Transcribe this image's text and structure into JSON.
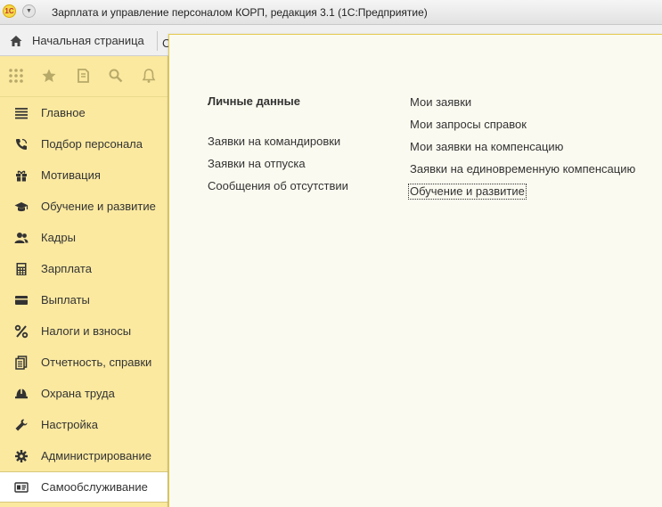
{
  "window": {
    "title": "Зарплата и управление персоналом КОРП, редакция 3.1  (1С:Предприятие)",
    "logo_text": "1С"
  },
  "tabs": {
    "home": "Начальная страница",
    "partial_tab": "С"
  },
  "quickbar": [
    "apps-grid-icon",
    "star-icon",
    "history-icon",
    "search-icon",
    "bell-icon"
  ],
  "sidebar": {
    "items": [
      {
        "label": "Главное",
        "icon": "menu-lines-icon"
      },
      {
        "label": "Подбор персонала",
        "icon": "phone-icon"
      },
      {
        "label": "Мотивация",
        "icon": "gift-icon"
      },
      {
        "label": "Обучение и развитие",
        "icon": "graduation-cap-icon"
      },
      {
        "label": "Кадры",
        "icon": "users-icon"
      },
      {
        "label": "Зарплата",
        "icon": "calculator-icon"
      },
      {
        "label": "Выплаты",
        "icon": "wallet-icon"
      },
      {
        "label": "Налоги и взносы",
        "icon": "percent-icon"
      },
      {
        "label": "Отчетность, справки",
        "icon": "reports-icon"
      },
      {
        "label": "Охрана труда",
        "icon": "helmet-icon"
      },
      {
        "label": "Настройка",
        "icon": "wrench-icon"
      },
      {
        "label": "Администрирование",
        "icon": "gear-icon"
      },
      {
        "label": "Самообслуживание",
        "icon": "id-card-icon"
      }
    ],
    "active_index": 12
  },
  "content": {
    "col1": {
      "heading": "Личные данные",
      "links": [
        "Заявки на командировки",
        "Заявки на отпуска",
        "Сообщения об отсутствии"
      ]
    },
    "col2": {
      "links": [
        "Мои заявки",
        "Мои запросы справок",
        "Мои заявки на компенсацию",
        "Заявки на единовременную компенсацию",
        "Обучение и развитие"
      ],
      "focused_index": 4
    }
  },
  "colors": {
    "sidebar_bg": "#fbe9a0",
    "panel_bg": "#fbfaf0",
    "accent": "#e3c84a"
  }
}
